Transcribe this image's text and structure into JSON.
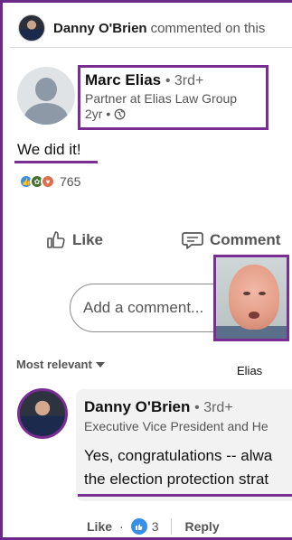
{
  "notification": {
    "actor": "Danny O'Brien",
    "text": "commented on this"
  },
  "post": {
    "author_name": "Marc Elias",
    "author_degree": "• 3rd+",
    "author_headline": "Partner at Elias Law Group",
    "time": "2yr •",
    "text": "We did it!",
    "reactions_count": "765"
  },
  "actions": {
    "like": "Like",
    "comment": "Comment"
  },
  "comment_input": {
    "placeholder": "Add a comment..."
  },
  "photo_caption": "Elias",
  "sort": {
    "label": "Most relevant"
  },
  "comment": {
    "author_name": "Danny O'Brien",
    "author_degree": "• 3rd+",
    "headline": "Executive Vice President and He",
    "text_line1": "Yes, congratulations -- alwa",
    "text_line2": "the election protection strat",
    "like_label": "Like",
    "dot": "·",
    "reaction_count": "3",
    "reply_label": "Reply"
  },
  "colors": {
    "highlight": "#7a2e94",
    "like_blue": "#378fe9"
  }
}
